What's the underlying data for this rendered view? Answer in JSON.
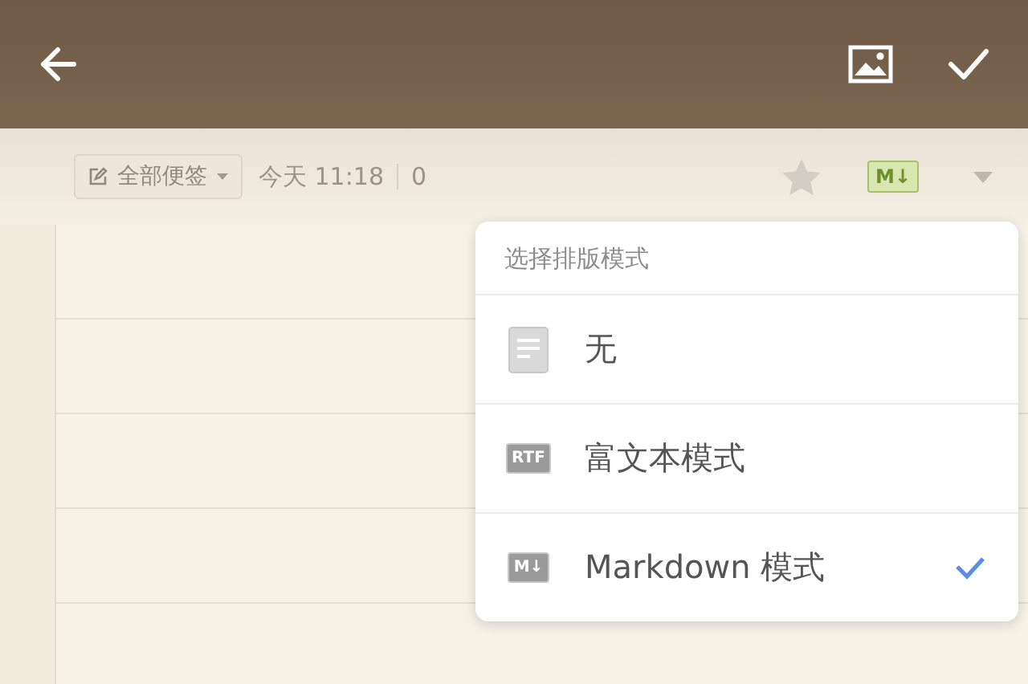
{
  "toolbar": {
    "buttons": [
      {
        "kind": "back"
      },
      {
        "kind": "image"
      },
      {
        "kind": "done"
      }
    ]
  },
  "meta": {
    "folder": "全部便签",
    "date": "今天 11:18",
    "count": "0",
    "starred": false,
    "format_badge": "M↓"
  },
  "format_menu": {
    "title": "选择排版模式",
    "items": [
      {
        "kind": "plain",
        "label": "无",
        "selected": false
      },
      {
        "kind": "rtf",
        "icon_text": "RTF",
        "label": "富文本模式",
        "selected": false
      },
      {
        "kind": "markdown",
        "icon_text": "M↓",
        "label": "Markdown 模式",
        "selected": true
      }
    ]
  }
}
